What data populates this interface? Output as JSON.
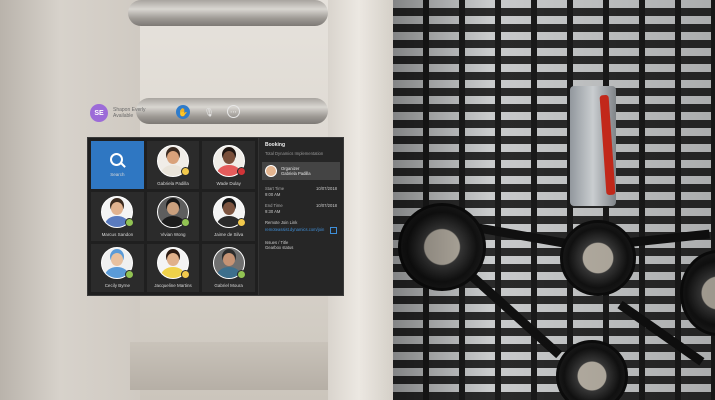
{
  "user": {
    "initials": "SE",
    "name": "Shapon Everly",
    "status": "Available"
  },
  "toolbar": {
    "hand_icon": "hand-icon",
    "mic_icon": "microphone-icon",
    "more_icon": "more-icon"
  },
  "grid": {
    "search_label": "Search",
    "contacts": [
      {
        "name": "Gabriela Padilla",
        "presence": "#f2c94c",
        "skin": "#d9a27b",
        "hair": "#3a2a20",
        "bg": "#f0ede8",
        "shirt": "#e9e4da"
      },
      {
        "name": "Wade Dulay",
        "presence": "#d13438",
        "skin": "#7a4f3a",
        "hair": "#1e1410",
        "bg": "#f0ede8",
        "shirt": "#e45b5b"
      },
      {
        "name": "Marcus Sandon",
        "presence": "#92c353",
        "skin": "#e2b38f",
        "hair": "#3b2a1e",
        "bg": "#f4f4f4",
        "shirt": "#5a7bbf"
      },
      {
        "name": "Vivian Wong",
        "presence": "#92c353",
        "skin": "#caa07e",
        "hair": "#161616",
        "bg": "#5e5e5e",
        "shirt": "#1c1c1c"
      },
      {
        "name": "Jaime de Silva",
        "presence": "#f2c94c",
        "skin": "#7d5541",
        "hair": "#151515",
        "bg": "#f4f4f4",
        "shirt": "#2a2a2a"
      },
      {
        "name": "Cecily Byrne",
        "presence": "#92c353",
        "skin": "#e8c19f",
        "hair": "#5a9bd8",
        "bg": "#f0f0f0",
        "shirt": "#5a9bd8"
      },
      {
        "name": "Jacqueline Martins",
        "presence": "#f2c94c",
        "skin": "#e0b08a",
        "hair": "#2b1a12",
        "bg": "#f4f4f4",
        "shirt": "#f0d24a"
      },
      {
        "name": "Gabriel Moura",
        "presence": "#92c353",
        "skin": "#c69374",
        "hair": "#2b2b2b",
        "bg": "#707070",
        "shirt": "#3d6f8c"
      }
    ]
  },
  "details": {
    "title": "Booking",
    "subtitle": "Total Dynamics Implementation",
    "organizer_label": "Organizer",
    "organizer_name": "Gabriela Padilla",
    "start_label": "Start Time",
    "start_time": "9:00 AM",
    "start_date": "10/07/2018",
    "end_label": "End Time",
    "end_time": "9:30 AM",
    "end_date": "10/07/2018",
    "remote_label": "Remote Join Link",
    "remote_link": "remoteassist.dynamics.com/join",
    "issue_label": "Issues / Title",
    "issue_value": "Gearbox status"
  }
}
